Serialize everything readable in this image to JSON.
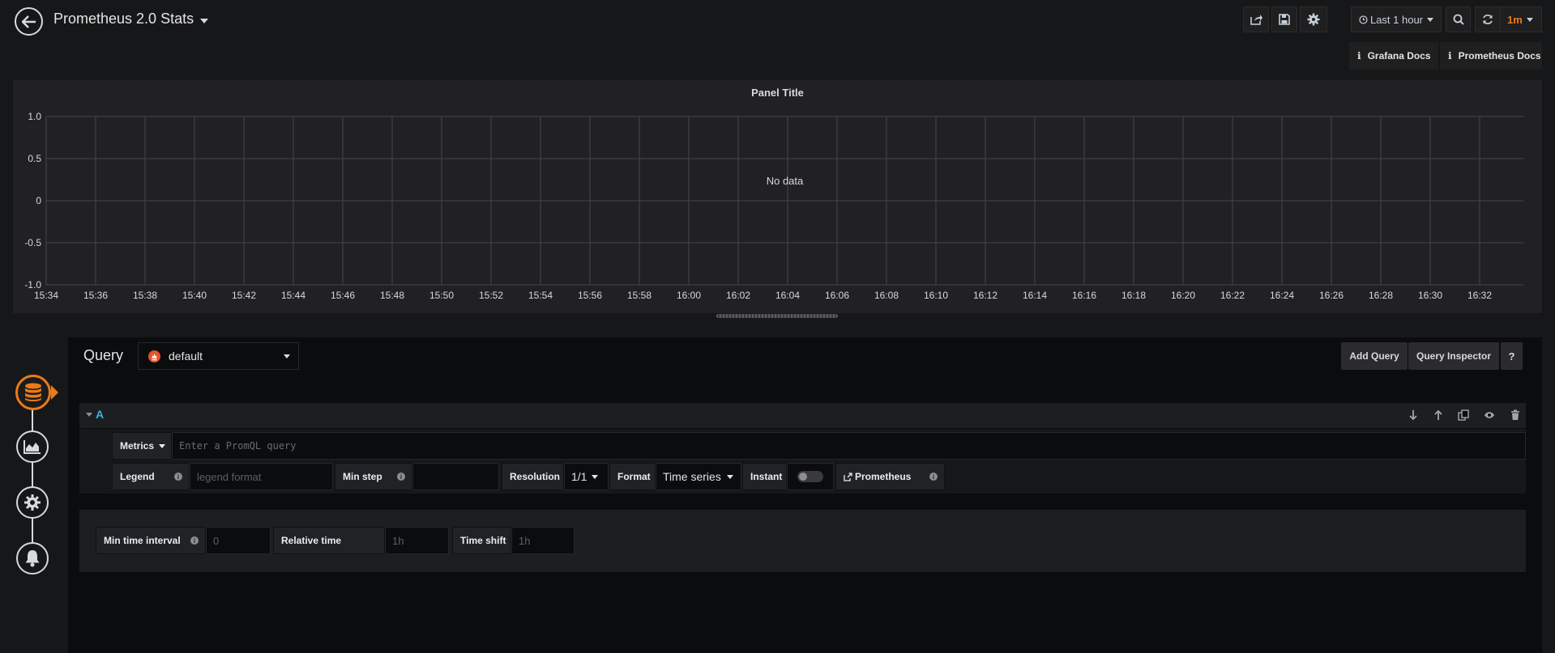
{
  "header": {
    "title": "Prometheus 2.0 Stats",
    "time_range": "Last 1 hour",
    "refresh": "1m",
    "docs": [
      "Grafana Docs",
      "Prometheus Docs"
    ]
  },
  "panel": {
    "title": "Panel Title",
    "no_data": "No data"
  },
  "chart_data": {
    "type": "line",
    "title": "Panel Title",
    "series": [],
    "annotation": "No data",
    "ylim": [
      -1.0,
      1.0
    ],
    "y_ticks": [
      "1.0",
      "0.5",
      "0",
      "-0.5",
      "-1.0"
    ],
    "x_ticks": [
      "15:34",
      "15:36",
      "15:38",
      "15:40",
      "15:42",
      "15:44",
      "15:46",
      "15:48",
      "15:50",
      "15:52",
      "15:54",
      "15:56",
      "15:58",
      "16:00",
      "16:02",
      "16:04",
      "16:06",
      "16:08",
      "16:10",
      "16:12",
      "16:14",
      "16:16",
      "16:18",
      "16:20",
      "16:22",
      "16:24",
      "16:26",
      "16:28",
      "16:30",
      "16:32"
    ],
    "grid": true,
    "colors": {
      "grid": "#464649",
      "text": "#d8d9da"
    }
  },
  "query": {
    "label": "Query",
    "datasource": "default",
    "add_query": "Add Query",
    "inspector": "Query Inspector",
    "help": "?"
  },
  "query_row": {
    "letter": "A",
    "metrics_label": "Metrics",
    "metrics_placeholder": "Enter a PromQL query",
    "legend_label": "Legend",
    "legend_placeholder": "legend format",
    "min_step_label": "Min step",
    "resolution_label": "Resolution",
    "resolution_value": "1/1",
    "format_label": "Format",
    "format_value": "Time series",
    "instant_label": "Instant",
    "prometheus_link": "Prometheus"
  },
  "options": {
    "min_interval_label": "Min time interval",
    "min_interval_placeholder": "0",
    "relative_time_label": "Relative time",
    "relative_time_placeholder": "1h",
    "time_shift_label": "Time shift",
    "time_shift_placeholder": "1h"
  },
  "colors": {
    "accent": "#eb7b18",
    "query_letter": "#33b5e5",
    "background": "#161719",
    "panel": "#212124"
  },
  "icons": [
    "back-arrow-icon",
    "caret-down-icon",
    "share-icon",
    "save-icon",
    "gear-icon",
    "clock-icon",
    "zoom-out-icon",
    "refresh-icon",
    "info-icon",
    "prometheus-icon",
    "database-icon",
    "chart-area-icon",
    "cog-icon",
    "bell-icon",
    "arrow-down-icon",
    "arrow-up-icon",
    "copy-icon",
    "eye-icon",
    "trash-icon",
    "external-link-icon"
  ]
}
